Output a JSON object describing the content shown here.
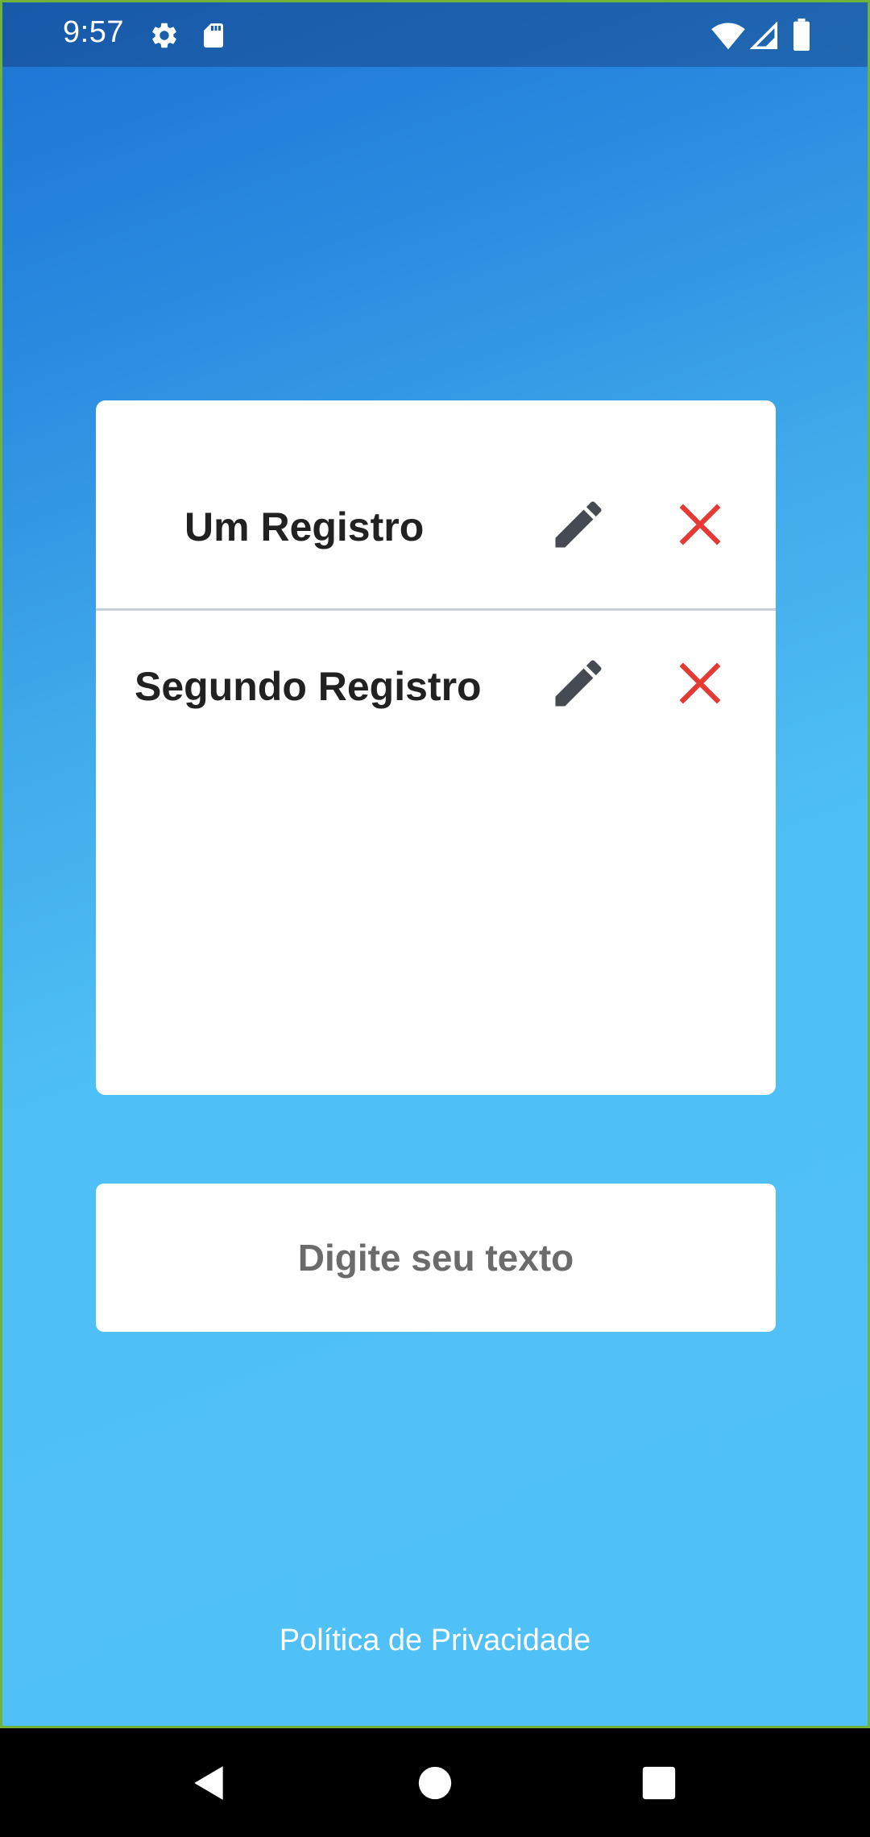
{
  "status_bar": {
    "time": "9:57",
    "icons": [
      "gear-icon",
      "sd-card-icon",
      "wifi-icon",
      "signal-icon",
      "battery-icon"
    ]
  },
  "records": [
    {
      "label": "Um Registro",
      "edit_icon": "pencil-icon",
      "delete_icon": "close-icon"
    },
    {
      "label": "Segundo Registro",
      "edit_icon": "pencil-icon",
      "delete_icon": "close-icon"
    }
  ],
  "input": {
    "placeholder": "Digite seu texto",
    "value": ""
  },
  "footer": {
    "privacy_link": "Política de Privacidade"
  },
  "nav_bar": {
    "icons": [
      "back-icon",
      "home-icon",
      "recents-icon"
    ]
  },
  "colors": {
    "gradient_top": "#1c72d4",
    "gradient_bottom": "#50c1f6",
    "edit_icon": "#464a52",
    "delete_icon": "#e53935",
    "card": "#ffffff",
    "divider": "#c9cfdc"
  }
}
